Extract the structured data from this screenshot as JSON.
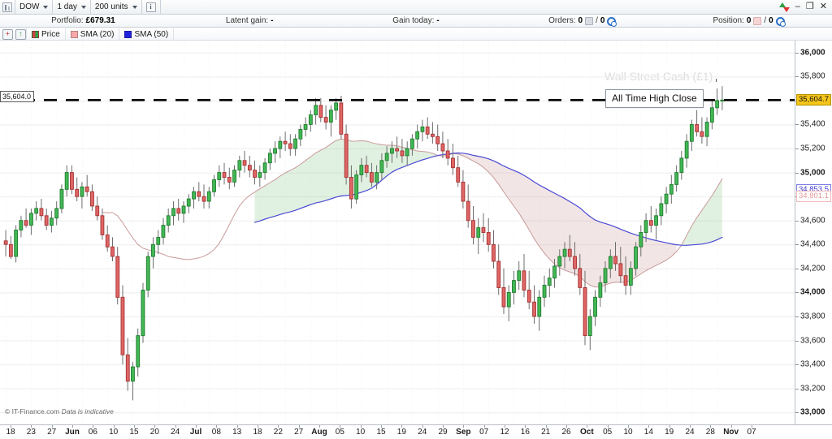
{
  "window": {
    "controls": [
      "refresh-icon",
      "minimize",
      "restore",
      "close"
    ],
    "minimize_glyph": "–",
    "restore_glyph": "❐",
    "close_glyph": "✕"
  },
  "toolbar": {
    "chart_icon": "chart-icon",
    "instrument": "DOW",
    "timeframe": "1 day",
    "units": "200 units",
    "info_glyph": "i"
  },
  "status": {
    "portfolio_label": "Portfolio:",
    "portfolio_value": "£679.31",
    "latent_gain_label": "Latent gain:",
    "latent_gain_value": "-",
    "gain_today_label": "Gain today:",
    "gain_today_value": "-",
    "orders_label": "Orders:",
    "orders_value": "0",
    "orders_sep": "/",
    "orders_value2": "0",
    "position_label": "Position:",
    "position_value": "0",
    "position_sep": "/",
    "position_value2": "0"
  },
  "legend": {
    "add_label": "+",
    "up_label": "↑",
    "items": [
      {
        "label": "Price",
        "color": "#2f9e44"
      },
      {
        "label": "SMA (20)",
        "color": "#f7a8a8"
      },
      {
        "label": "SMA (50)",
        "color": "#2222dd"
      }
    ]
  },
  "chart_meta": {
    "watermark": "Wall Street Cash (£1)",
    "footnote_prefix": "© IT-Finance.com",
    "footnote_italic": "Data is indicative",
    "annotation": "All Time High Close",
    "left_price_tag": "35,604.0",
    "current_price_tag": "35,604.7",
    "sma50_tag": "34,853.5",
    "sma20_tag": "34,801.1"
  },
  "colors": {
    "up": "#42b854",
    "up_border": "#1f7a2e",
    "down": "#e06666",
    "down_border": "#a33030",
    "sma50_line": "#4a4ad6",
    "sma20_line": "#c99a9a",
    "band_up": "rgba(120,190,120,0.22)",
    "band_down": "rgba(205,150,150,0.25)",
    "grid": "#ececec",
    "axis": "#b9bfc7",
    "highlight": "#f5c518"
  },
  "chart_data": {
    "type": "candlestick",
    "title": "Wall Street Cash (£1)",
    "instrument": "DOW",
    "timeframe": "1 day",
    "bars_requested": "200 units",
    "xlabel": "",
    "ylabel": "",
    "ylim": [
      32900,
      36100
    ],
    "grid": true,
    "legend_position": "top-left",
    "y_ticks": [
      33000,
      33200,
      33400,
      33600,
      33800,
      34000,
      34200,
      34400,
      34600,
      34800,
      35000,
      35200,
      35400,
      35600,
      35800,
      36000
    ],
    "y_tick_labels": [
      "33,000",
      "33,200",
      "33,400",
      "33,600",
      "33,800",
      "34,000",
      "34,200",
      "34,400",
      "34,600",
      "34,800",
      "35,000",
      "35,200",
      "35,400",
      "35,600",
      "35,800",
      "36,000"
    ],
    "y_major": [
      33000,
      34000,
      35000,
      36000
    ],
    "x_tick_labels": [
      "18",
      "23",
      "27",
      "Jun",
      "06",
      "10",
      "15",
      "20",
      "24",
      "Jul",
      "08",
      "13",
      "18",
      "22",
      "27",
      "Aug",
      "05",
      "10",
      "15",
      "19",
      "24",
      "29",
      "Sep",
      "07",
      "12",
      "16",
      "21",
      "26",
      "Oct",
      "05",
      "10",
      "14",
      "19",
      "24",
      "28",
      "Nov",
      "07"
    ],
    "x_month_labels": [
      "Jun",
      "Jul",
      "Aug",
      "Sep",
      "Oct",
      "Nov"
    ],
    "annotations": [
      {
        "text": "All Time High Close",
        "y": 35604.0,
        "type": "horizontal-dashed-line"
      }
    ],
    "reference_lines": [
      {
        "label": "35,604.0",
        "value": 35604.0,
        "style": "dashed",
        "color": "#000000"
      }
    ],
    "series": [
      {
        "name": "SMA (20)",
        "color": "#c99a9a",
        "last_value": 34801.1
      },
      {
        "name": "SMA (50)",
        "color": "#4a4ad6",
        "last_value": 34853.5
      }
    ],
    "last_close": 35604.7,
    "ohlc": [
      [
        34430,
        34520,
        34300,
        34400
      ],
      [
        34400,
        34470,
        34280,
        34300
      ],
      [
        34300,
        34560,
        34250,
        34520
      ],
      [
        34520,
        34640,
        34460,
        34600
      ],
      [
        34600,
        34700,
        34540,
        34560
      ],
      [
        34560,
        34700,
        34480,
        34660
      ],
      [
        34660,
        34760,
        34600,
        34700
      ],
      [
        34700,
        34780,
        34600,
        34640
      ],
      [
        34640,
        34700,
        34520,
        34560
      ],
      [
        34560,
        34680,
        34500,
        34620
      ],
      [
        34620,
        34760,
        34560,
        34700
      ],
      [
        34700,
        34900,
        34660,
        34860
      ],
      [
        34860,
        35060,
        34800,
        35000
      ],
      [
        35000,
        35060,
        34820,
        34860
      ],
      [
        34860,
        34960,
        34760,
        34800
      ],
      [
        34800,
        34920,
        34700,
        34880
      ],
      [
        34880,
        34980,
        34800,
        34840
      ],
      [
        34840,
        34900,
        34680,
        34720
      ],
      [
        34720,
        34800,
        34600,
        34640
      ],
      [
        34640,
        34700,
        34440,
        34480
      ],
      [
        34480,
        34560,
        34340,
        34380
      ],
      [
        34380,
        34460,
        34260,
        34300
      ],
      [
        34300,
        34380,
        33900,
        33960
      ],
      [
        33960,
        34060,
        33400,
        33480
      ],
      [
        33480,
        33620,
        33180,
        33260
      ],
      [
        33260,
        33420,
        33100,
        33380
      ],
      [
        33380,
        33700,
        33300,
        33640
      ],
      [
        33640,
        34080,
        33580,
        34020
      ],
      [
        34020,
        34340,
        33960,
        34300
      ],
      [
        34300,
        34460,
        34200,
        34400
      ],
      [
        34400,
        34520,
        34320,
        34460
      ],
      [
        34460,
        34620,
        34400,
        34560
      ],
      [
        34560,
        34700,
        34500,
        34640
      ],
      [
        34640,
        34760,
        34560,
        34700
      ],
      [
        34700,
        34780,
        34600,
        34660
      ],
      [
        34660,
        34760,
        34580,
        34720
      ],
      [
        34720,
        34820,
        34660,
        34780
      ],
      [
        34780,
        34880,
        34700,
        34840
      ],
      [
        34840,
        34920,
        34760,
        34800
      ],
      [
        34800,
        34900,
        34700,
        34760
      ],
      [
        34760,
        34880,
        34700,
        34840
      ],
      [
        34840,
        34980,
        34800,
        34940
      ],
      [
        34940,
        35060,
        34880,
        35000
      ],
      [
        35000,
        35080,
        34900,
        34960
      ],
      [
        34960,
        35040,
        34860,
        34920
      ],
      [
        34920,
        35060,
        34880,
        35020
      ],
      [
        35020,
        35140,
        34960,
        35100
      ],
      [
        35100,
        35180,
        35000,
        35060
      ],
      [
        35060,
        35140,
        34960,
        35020
      ],
      [
        35020,
        35100,
        34900,
        34960
      ],
      [
        34960,
        35060,
        34880,
        35000
      ],
      [
        35000,
        35120,
        34940,
        35080
      ],
      [
        35080,
        35200,
        35020,
        35160
      ],
      [
        35160,
        35260,
        35080,
        35200
      ],
      [
        35200,
        35300,
        35120,
        35260
      ],
      [
        35260,
        35340,
        35180,
        35240
      ],
      [
        35240,
        35320,
        35140,
        35200
      ],
      [
        35200,
        35320,
        35140,
        35280
      ],
      [
        35280,
        35400,
        35220,
        35360
      ],
      [
        35360,
        35460,
        35300,
        35400
      ],
      [
        35400,
        35520,
        35340,
        35480
      ],
      [
        35480,
        35620,
        35400,
        35560
      ],
      [
        35560,
        35620,
        35420,
        35460
      ],
      [
        35460,
        35560,
        35360,
        35420
      ],
      [
        35420,
        35560,
        35300,
        35520
      ],
      [
        35520,
        35620,
        35440,
        35580
      ],
      [
        35580,
        35640,
        35280,
        35320
      ],
      [
        35320,
        35400,
        34900,
        34960
      ],
      [
        34960,
        35060,
        34700,
        34780
      ],
      [
        34780,
        35020,
        34740,
        34980
      ],
      [
        34980,
        35120,
        34920,
        35060
      ],
      [
        35060,
        35140,
        34960,
        35000
      ],
      [
        35000,
        35080,
        34880,
        34920
      ],
      [
        34920,
        35060,
        34860,
        35000
      ],
      [
        35000,
        35160,
        34940,
        35100
      ],
      [
        35100,
        35220,
        35040,
        35160
      ],
      [
        35160,
        35260,
        35080,
        35200
      ],
      [
        35200,
        35300,
        35120,
        35180
      ],
      [
        35180,
        35280,
        35080,
        35140
      ],
      [
        35140,
        35260,
        35060,
        35200
      ],
      [
        35200,
        35320,
        35140,
        35280
      ],
      [
        35280,
        35400,
        35200,
        35340
      ],
      [
        35340,
        35440,
        35260,
        35380
      ],
      [
        35380,
        35460,
        35280,
        35320
      ],
      [
        35320,
        35420,
        35240,
        35300
      ],
      [
        35300,
        35400,
        35180,
        35240
      ],
      [
        35240,
        35340,
        35120,
        35180
      ],
      [
        35180,
        35280,
        35060,
        35120
      ],
      [
        35120,
        35240,
        34980,
        35040
      ],
      [
        35040,
        35140,
        34880,
        34920
      ],
      [
        34920,
        35020,
        34700,
        34760
      ],
      [
        34760,
        34900,
        34540,
        34600
      ],
      [
        34600,
        34720,
        34400,
        34460
      ],
      [
        34460,
        34620,
        34320,
        34540
      ],
      [
        34540,
        34660,
        34420,
        34500
      ],
      [
        34500,
        34620,
        34340,
        34400
      ],
      [
        34400,
        34520,
        34200,
        34260
      ],
      [
        34260,
        34400,
        33980,
        34040
      ],
      [
        34040,
        34200,
        33820,
        33880
      ],
      [
        33880,
        34060,
        33760,
        34000
      ],
      [
        34000,
        34180,
        33900,
        34100
      ],
      [
        34100,
        34260,
        34020,
        34180
      ],
      [
        34180,
        34320,
        33960,
        34020
      ],
      [
        34020,
        34180,
        33860,
        33920
      ],
      [
        33920,
        34060,
        33740,
        33800
      ],
      [
        33800,
        34020,
        33680,
        33960
      ],
      [
        33960,
        34140,
        33880,
        34060
      ],
      [
        34060,
        34200,
        33960,
        34120
      ],
      [
        34120,
        34280,
        34040,
        34220
      ],
      [
        34220,
        34360,
        34140,
        34300
      ],
      [
        34300,
        34420,
        34200,
        34360
      ],
      [
        34360,
        34480,
        34260,
        34300
      ],
      [
        34300,
        34420,
        34140,
        34200
      ],
      [
        34200,
        34320,
        33980,
        34040
      ],
      [
        34040,
        34180,
        33560,
        33640
      ],
      [
        33640,
        33860,
        33520,
        33800
      ],
      [
        33800,
        34020,
        33720,
        33960
      ],
      [
        33960,
        34140,
        33880,
        34080
      ],
      [
        34080,
        34260,
        34000,
        34200
      ],
      [
        34200,
        34360,
        34120,
        34300
      ],
      [
        34300,
        34420,
        34180,
        34240
      ],
      [
        34240,
        34380,
        34080,
        34140
      ],
      [
        34140,
        34300,
        33980,
        34060
      ],
      [
        34060,
        34260,
        33980,
        34200
      ],
      [
        34200,
        34420,
        34140,
        34380
      ],
      [
        34380,
        34560,
        34300,
        34500
      ],
      [
        34500,
        34660,
        34420,
        34600
      ],
      [
        34600,
        34720,
        34500,
        34560
      ],
      [
        34560,
        34700,
        34440,
        34640
      ],
      [
        34640,
        34800,
        34560,
        34740
      ],
      [
        34740,
        34880,
        34660,
        34820
      ],
      [
        34820,
        34980,
        34740,
        34900
      ],
      [
        34900,
        35060,
        34840,
        35000
      ],
      [
        35000,
        35180,
        34940,
        35120
      ],
      [
        35120,
        35320,
        35040,
        35260
      ],
      [
        35260,
        35440,
        35180,
        35400
      ],
      [
        35400,
        35520,
        35300,
        35340
      ],
      [
        35340,
        35460,
        35240,
        35300
      ],
      [
        35300,
        35460,
        35220,
        35420
      ],
      [
        35420,
        35600,
        35360,
        35540
      ],
      [
        35540,
        35700,
        35480,
        35600
      ],
      [
        35600,
        35720,
        35520,
        35604
      ]
    ]
  }
}
